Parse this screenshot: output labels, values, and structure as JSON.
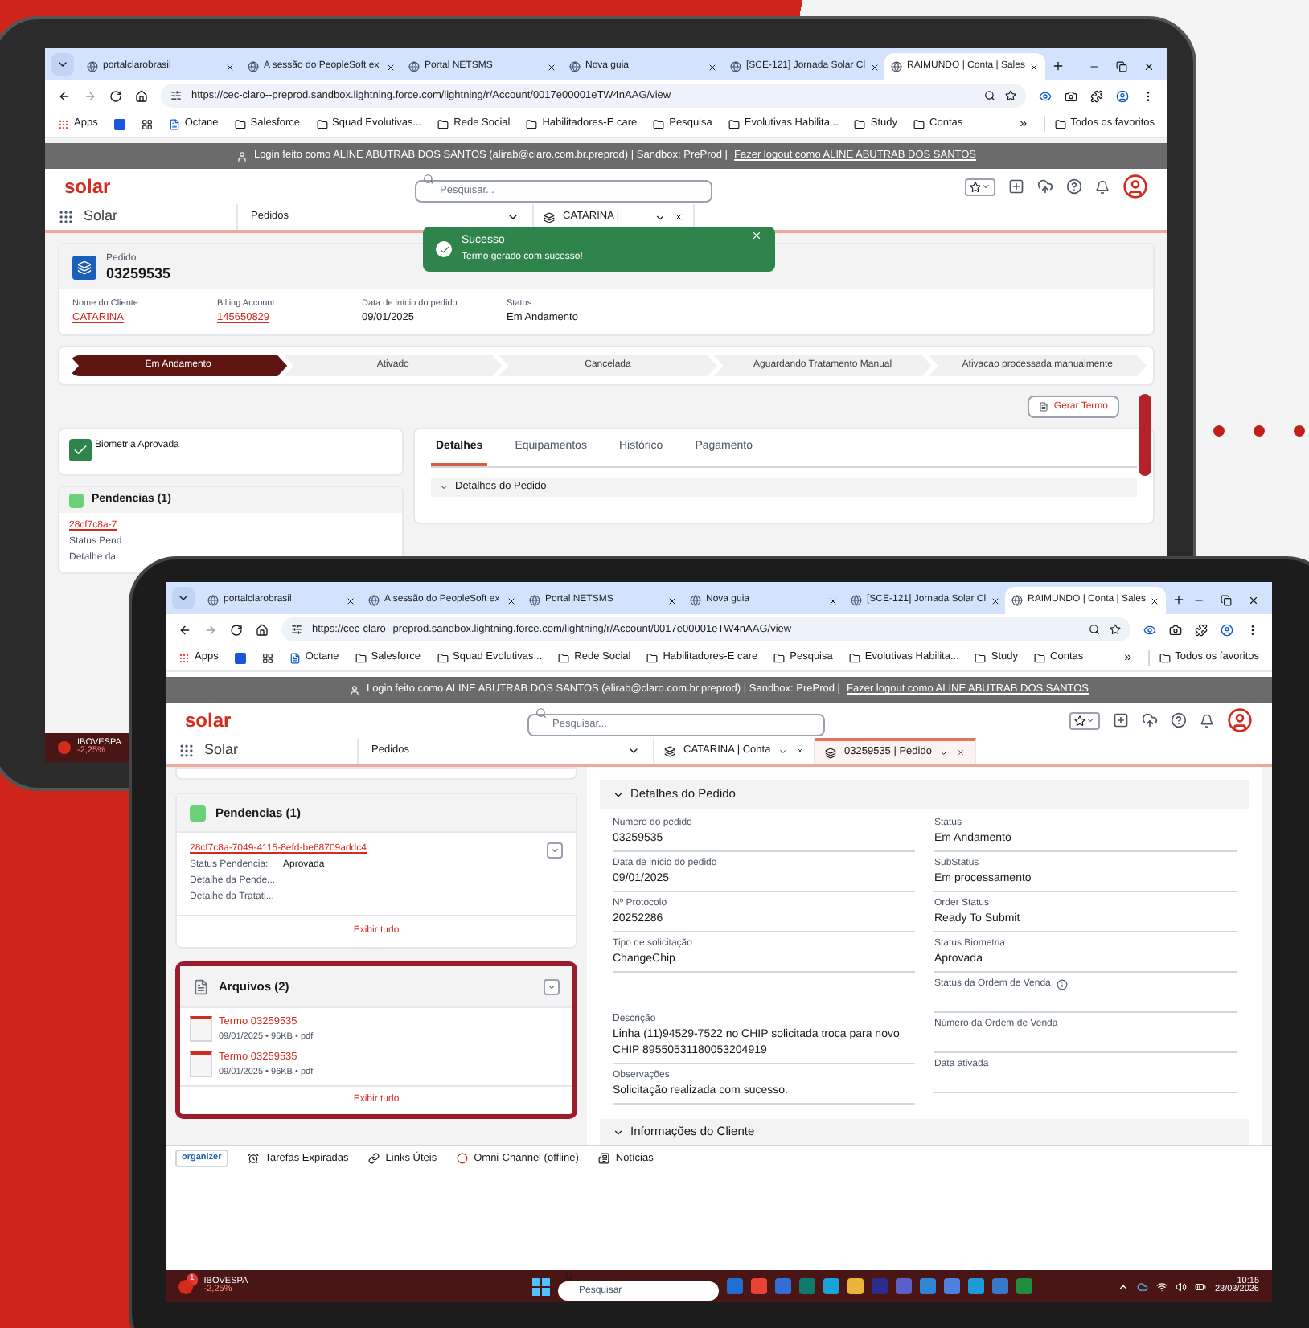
{
  "back_screen": {
    "browser": {
      "tabs": [
        {
          "label": "portalclarobrasil",
          "selected": false
        },
        {
          "label": "A sessão do PeopleSoft ex",
          "selected": false
        },
        {
          "label": "Portal NETSMS",
          "selected": false
        },
        {
          "label": "Nova guia",
          "selected": false
        },
        {
          "label": "[SCE-121] Jornada Solar Cl",
          "selected": false
        },
        {
          "label": "RAIMUNDO | Conta | Sales",
          "selected": true
        }
      ],
      "url": "https://cec-claro--preprod.sandbox.lightning.force.com/lightning/r/Account/0017e00001eTW4nAAG/view",
      "bookmarks": [
        {
          "label": "Apps",
          "kind": "apps"
        },
        {
          "label": "Octane",
          "kind": "app"
        },
        {
          "label": "Salesforce",
          "kind": "folder"
        },
        {
          "label": "Squad Evolutivas...",
          "kind": "folder"
        },
        {
          "label": "Rede Social",
          "kind": "folder"
        },
        {
          "label": "Habilitadores-E care",
          "kind": "folder"
        },
        {
          "label": "Pesquisa",
          "kind": "folder"
        },
        {
          "label": "Evolutivas Habilita...",
          "kind": "folder"
        },
        {
          "label": "Study",
          "kind": "folder"
        },
        {
          "label": "Contas",
          "kind": "folder"
        }
      ],
      "more": "»",
      "all_bookmarks": "Todos os favoritos"
    },
    "banner": {
      "text": "Login feito como ALINE ABUTRAB DOS SANTOS (alirab@claro.com.br.preprod) | Sandbox: PreProd |",
      "link": "Fazer logout como ALINE ABUTRAB DOS SANTOS"
    },
    "header": {
      "logo": "solar",
      "search_placeholder": "Pesquisar..."
    },
    "nav": {
      "app_name": "Solar",
      "object": "Pedidos",
      "tabs": [
        {
          "label": "CATARINA |",
          "selected": false
        }
      ]
    },
    "toast": {
      "title": "Sucesso",
      "message": "Termo gerado com sucesso!"
    },
    "record": {
      "type": "Pedido",
      "number": "03259535",
      "fields": [
        {
          "label": "Nome do Cliente",
          "value": "CATARINA",
          "kind": "link"
        },
        {
          "label": "Billing Account",
          "value": "145650829",
          "kind": "link"
        },
        {
          "label": "Data de início do pedido",
          "value": "09/01/2025",
          "kind": "text"
        },
        {
          "label": "Status",
          "value": "Em Andamento",
          "kind": "text"
        }
      ]
    },
    "path": [
      {
        "label": "Em Andamento",
        "selected": true
      },
      {
        "label": "Ativado",
        "selected": false
      },
      {
        "label": "Cancelada",
        "selected": false
      },
      {
        "label": "Aguardando Tratamento Manual",
        "selected": false
      },
      {
        "label": "Ativacao processada manualmente",
        "selected": false
      }
    ],
    "action_button": "Gerar Termo",
    "biometria": {
      "label": "Biometria Aprovada",
      "checked": true
    },
    "detail_tabs": [
      {
        "label": "Detalhes",
        "selected": true
      },
      {
        "label": "Equipamentos",
        "selected": false
      },
      {
        "label": "Histórico",
        "selected": false
      },
      {
        "label": "Pagamento",
        "selected": false
      }
    ],
    "section": "Detalhes do Pedido",
    "pendencias": {
      "title": "Pendencias (1)",
      "fragments": [
        "28cf7c8a-7",
        "Status Pend",
        "Detalhe da"
      ]
    },
    "taskbar": {
      "ticker": "IBOVESPA",
      "change": "-2,25%"
    }
  },
  "front_screen": {
    "browser": {
      "tabs": [
        {
          "label": "portalclarobrasil",
          "selected": false
        },
        {
          "label": "A sessão do PeopleSoft ex",
          "selected": false
        },
        {
          "label": "Portal NETSMS",
          "selected": false
        },
        {
          "label": "Nova guia",
          "selected": false
        },
        {
          "label": "[SCE-121] Jornada Solar Cl",
          "selected": false
        },
        {
          "label": "RAIMUNDO | Conta | Sales",
          "selected": true
        }
      ],
      "url": "https://cec-claro--preprod.sandbox.lightning.force.com/lightning/r/Account/0017e00001eTW4nAAG/view",
      "bookmarks": [
        {
          "label": "Apps",
          "kind": "apps"
        },
        {
          "label": "Octane",
          "kind": "app"
        },
        {
          "label": "Salesforce",
          "kind": "folder"
        },
        {
          "label": "Squad Evolutivas...",
          "kind": "folder"
        },
        {
          "label": "Rede Social",
          "kind": "folder"
        },
        {
          "label": "Habilitadores-E care",
          "kind": "folder"
        },
        {
          "label": "Pesquisa",
          "kind": "folder"
        },
        {
          "label": "Evolutivas Habilita...",
          "kind": "folder"
        },
        {
          "label": "Study",
          "kind": "folder"
        },
        {
          "label": "Contas",
          "kind": "folder"
        }
      ],
      "more": "»",
      "all_bookmarks": "Todos os favoritos"
    },
    "banner": {
      "text": "Login feito como ALINE ABUTRAB DOS SANTOS (alirab@claro.com.br.preprod) | Sandbox: PreProd |",
      "link": "Fazer logout como ALINE ABUTRAB DOS SANTOS"
    },
    "header": {
      "logo": "solar",
      "search_placeholder": "Pesquisar..."
    },
    "nav": {
      "app_name": "Solar",
      "object": "Pedidos",
      "tabs": [
        {
          "label": "CATARINA | Conta",
          "selected": false
        },
        {
          "label": "03259535 | Pedido",
          "selected": true
        }
      ]
    },
    "pendencias": {
      "title": "Pendencias (1)",
      "link": "28cf7c8a-7049-4115-8efd-be68709addc4",
      "fields": [
        {
          "label": "Status Pendencia:",
          "value": "Aprovada"
        },
        {
          "label": "Detalhe da Pende..."
        },
        {
          "label": "Detalhe da Tratati..."
        }
      ],
      "footer": "Exibir tudo"
    },
    "arquivos": {
      "title": "Arquivos (2)",
      "highlighted": true,
      "files": [
        {
          "name": "Termo 03259535",
          "meta": "09/01/2025 • 96KB • pdf"
        },
        {
          "name": "Termo 03259535",
          "meta": "09/01/2025 • 96KB • pdf"
        }
      ],
      "footer": "Exibir tudo"
    },
    "details": {
      "title": "Detalhes do Pedido",
      "left": [
        {
          "label": "Número do pedido",
          "value": "03259535",
          "kind": "field"
        },
        {
          "label": "Data de início do pedido",
          "value": "09/01/2025",
          "kind": "field"
        },
        {
          "label": "Nº Protocolo",
          "value": "20252286",
          "kind": "field"
        },
        {
          "label": "Tipo de solicitação",
          "value": "ChangeChip",
          "kind": "field"
        },
        {
          "label": "Descrição",
          "value": "Linha (11)94529-7522 no CHIP solicitada troca para novo CHIP 89550531180053204919",
          "kind": "long"
        },
        {
          "label": "Observações",
          "value": "Solicitação realizada com sucesso.",
          "kind": "field"
        }
      ],
      "right": [
        {
          "label": "Status",
          "value": "Em Andamento",
          "kind": "field"
        },
        {
          "label": "SubStatus",
          "value": "Em processamento",
          "kind": "field"
        },
        {
          "label": "Order Status",
          "value": "Ready To Submit",
          "kind": "field"
        },
        {
          "label": "Status Biometria",
          "value": "Aprovada",
          "kind": "field"
        },
        {
          "label": "Status da Ordem de Venda",
          "kind": "info"
        },
        {
          "label": "Número da Ordem de Venda",
          "kind": "field"
        },
        {
          "label": "Data ativada",
          "kind": "field"
        }
      ]
    },
    "next_section": "Informações do Cliente",
    "utility_bar": [
      {
        "label": "Tarefas Expiradas",
        "kind": "alarm"
      },
      {
        "label": "Links Úteis",
        "kind": "link"
      },
      {
        "label": "Omni-Channel (offline)",
        "kind": "omni"
      },
      {
        "label": "Notícias",
        "kind": "news"
      }
    ],
    "organizer": "organizer",
    "taskbar": {
      "ticker": "IBOVESPA",
      "change": "-2,25%",
      "badge": "1",
      "search_placeholder": "Pesquisar",
      "time": "10:15",
      "date": "23/03/2026"
    }
  }
}
